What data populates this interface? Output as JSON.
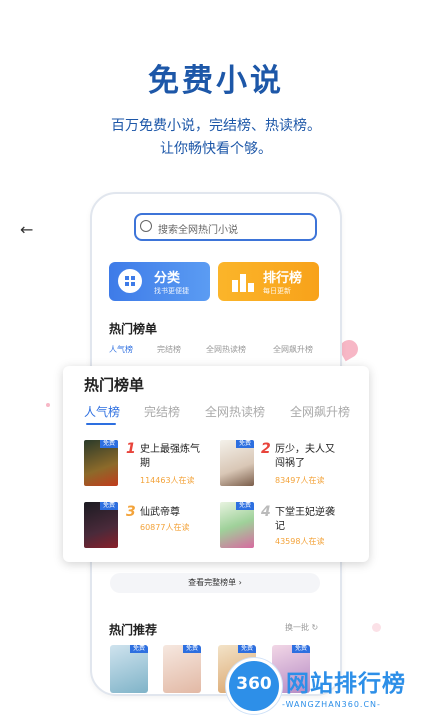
{
  "header": {
    "headline": "免费小说",
    "sub1": "百万免费小说，完结榜、热读榜。",
    "sub2": "让你畅快看个够。"
  },
  "search": {
    "placeholder": "搜索全网热门小说"
  },
  "tiles": [
    {
      "title": "分类",
      "sub": "找书更便捷"
    },
    {
      "title": "排行榜",
      "sub": "每日更新"
    }
  ],
  "hot_section": {
    "title": "热门榜单",
    "tabs": [
      "人气榜",
      "完结榜",
      "全网热读榜",
      "全网飙升榜"
    ]
  },
  "card": {
    "title": "热门榜单",
    "tabs": [
      "人气榜",
      "完结榜",
      "全网热读榜",
      "全网飙升榜"
    ],
    "books": [
      {
        "rank": "1",
        "title": "史上最强炼气期",
        "readers": "114463人在读",
        "badge": "免费"
      },
      {
        "rank": "2",
        "title": "厉少，夫人又闯祸了",
        "readers": "83497人在读",
        "badge": "免费"
      },
      {
        "rank": "3",
        "title": "仙武帝尊",
        "readers": "60877人在读",
        "badge": "免费"
      },
      {
        "rank": "4",
        "title": "下堂王妃逆袭记",
        "readers": "43598人在读",
        "badge": "免费"
      }
    ]
  },
  "complete_list": "查看完整榜单 ›",
  "recommend": {
    "title": "热门推荐",
    "refresh": "换一批 ↻",
    "badges": [
      "免费",
      "免费",
      "免费",
      "免费"
    ]
  },
  "watermark": {
    "logo": "360",
    "name": "网站排行榜",
    "url": "-WANGZHAN360.CN-"
  },
  "colors": {
    "brand": "#1d57a8",
    "accent": "#2d6fe0",
    "orange": "#f8a21a",
    "rank1": "#e8443b",
    "rank2": "#e8443b",
    "rank3": "#f3a33a"
  }
}
